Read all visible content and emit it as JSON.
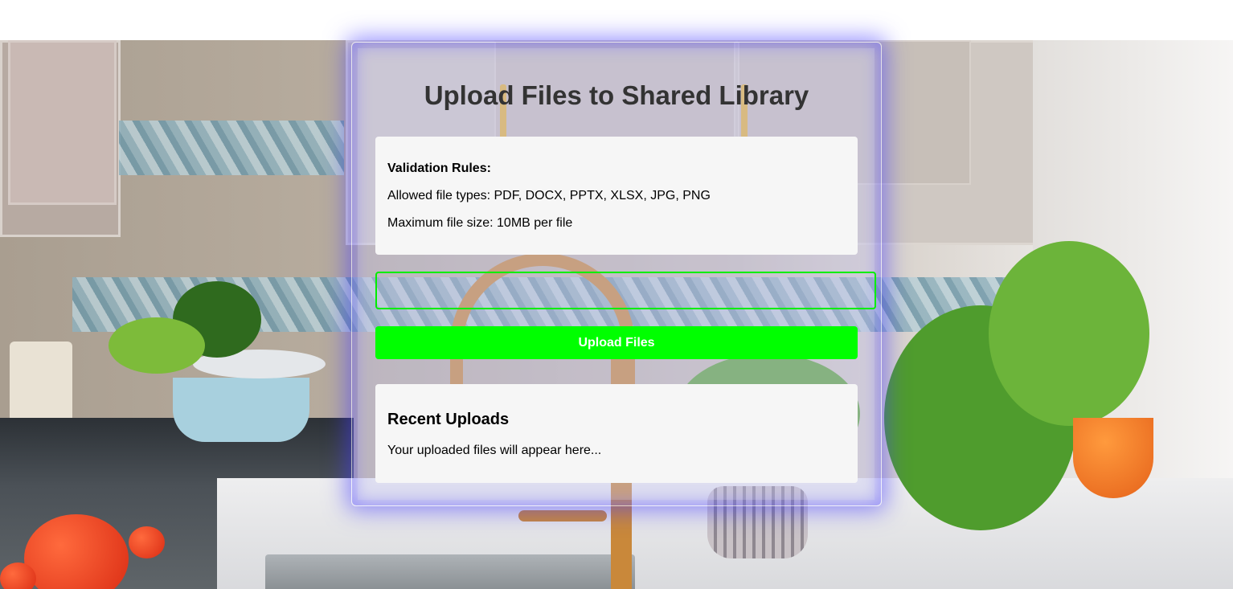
{
  "page": {
    "title": "Upload Files to Shared Library"
  },
  "validation": {
    "heading": "Validation Rules:",
    "allowed_types": "Allowed file types: PDF, DOCX, PPTX, XLSX, JPG, PNG",
    "max_size": "Maximum file size: 10MB per file"
  },
  "upload": {
    "button_label": "Upload Files"
  },
  "recent": {
    "heading": "Recent Uploads",
    "empty_text": "Your uploaded files will appear here..."
  },
  "colors": {
    "accent_green": "#00ff00",
    "card_glow": "#4a3cff",
    "panel_bg": "#f6f6f6",
    "title_text": "#333333"
  }
}
